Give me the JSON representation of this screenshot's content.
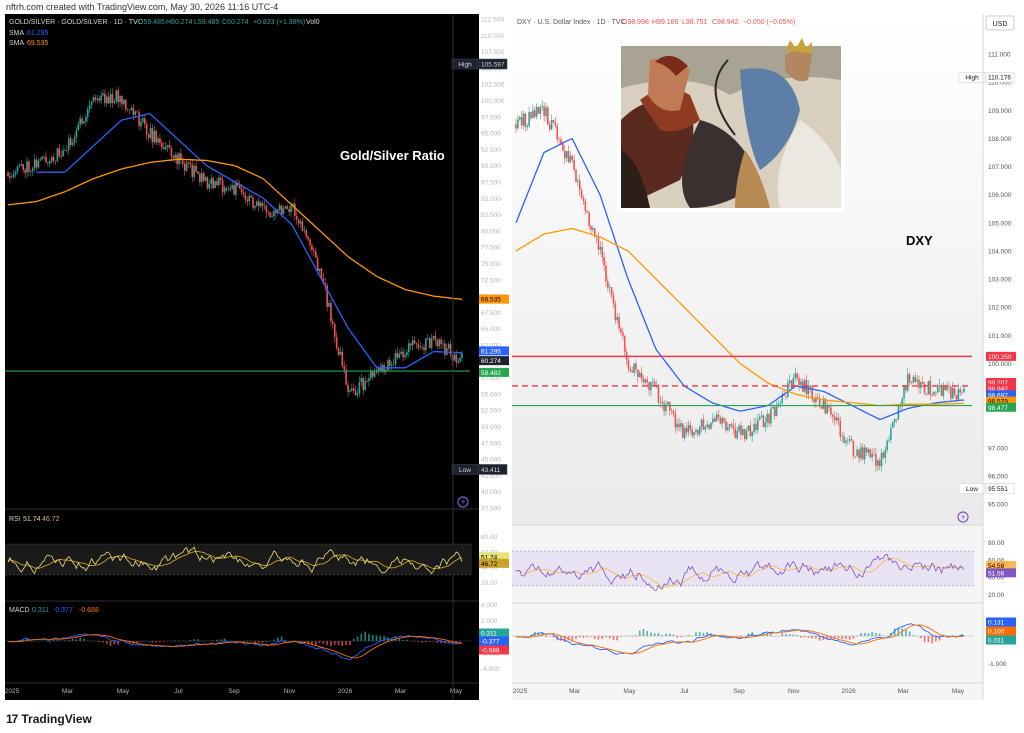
{
  "header": "nftrh.com created with TradingView.com, May 30, 2026 11:16 UTC-4",
  "footer": {
    "logo_mark": "17",
    "brand": "TradingView"
  },
  "colors": {
    "sma_fast": "#2962ff",
    "sma_slow": "#ff9800",
    "support": "#26a651",
    "resistance": "#f23645",
    "up": "#26a69a",
    "down": "#ef5350",
    "rsi_left": "#e8e079",
    "rsi_right": "#7e57c2",
    "macd": "#2962ff",
    "signal": "#ff6d00"
  },
  "left_panel": {
    "title": "GOLD/SILVER · GOLD/SILVER · 1D · TVC",
    "ohlc": {
      "o": "O59.485",
      "h": "H60.274",
      "l": "L59.485",
      "c": "C60.274",
      "chg": "+0.823 (+1.38%)",
      "vol": "Vol0"
    },
    "sma1": {
      "label": "SMA",
      "value": "61.295"
    },
    "sma2": {
      "label": "SMA",
      "value": "69.535"
    },
    "annotation": "Gold/Silver Ratio",
    "high_label": "High",
    "high_value": "105.597",
    "low_label": "Low",
    "low_value": "43.411",
    "price_tags": [
      {
        "text": "69.535",
        "price": 69.535,
        "bg": "#ff9800",
        "fg": "#000000"
      },
      {
        "text": "61.295",
        "price": 61.6,
        "bg": "#2962ff",
        "fg": "#ffffff"
      },
      {
        "text": "60.274",
        "price": 60.1,
        "bg": "#1e222d",
        "fg": "#ffffff"
      },
      {
        "text": "58.482",
        "price": 58.3,
        "bg": "#26a651",
        "fg": "#ffffff"
      }
    ],
    "rsi": {
      "label": "RSI",
      "v1": "51.74",
      "v2": "46.72",
      "ticks": [
        "60.00",
        "40.00",
        "20.00"
      ],
      "tag1": "51.74",
      "tag2": "46.72",
      "tick_top": "80.00"
    },
    "macd": {
      "label": "MACD",
      "v1": "0.311",
      "v2": "-0.377",
      "v3": "-0.688",
      "ticks": [
        "4.000",
        "2.000",
        "-2.000",
        "-4.000"
      ],
      "tag1": "0.311",
      "tag2": "-0.377",
      "tag3": "-0.688"
    },
    "x_labels": [
      "2025",
      "Mar",
      "May",
      "Jul",
      "Sep",
      "Nov",
      "2026",
      "Mar",
      "May"
    ]
  },
  "right_panel": {
    "title": "DXY · U.S. Dollar Index · 1D · TVC",
    "ohlc": {
      "o": "O98.998",
      "h": "H99.186",
      "l": "L98.751",
      "c": "C98.942",
      "chg": "−0.050 (−0.05%)"
    },
    "currency": "USD",
    "annotation": "DXY",
    "high_label": "High",
    "high_value": "110.176",
    "low_label": "Low",
    "low_value": "95.551",
    "price_tags": [
      {
        "text": "100.250",
        "price": 100.25,
        "bg": "#f23645",
        "fg": "#ffffff"
      },
      {
        "text": "99.207",
        "price": 99.32,
        "bg": "#f23645",
        "fg": "#ffffff"
      },
      {
        "text": "98.942",
        "price": 99.1,
        "bg": "#f23645",
        "fg": "#ffffff"
      },
      {
        "text": "98.697",
        "price": 98.88,
        "bg": "#2962ff",
        "fg": "#ffffff"
      },
      {
        "text": "98.579",
        "price": 98.66,
        "bg": "#ff9800",
        "fg": "#000000"
      },
      {
        "text": "98.477",
        "price": 98.44,
        "bg": "#26a651",
        "fg": "#ffffff"
      }
    ],
    "rsi": {
      "ticks": [
        "80.00",
        "60.00",
        "40.00",
        "20.00"
      ],
      "tag1": "54.58",
      "tag2": "51.56"
    },
    "macd": {
      "ticks": [
        "0.131",
        "0.100",
        "0.031",
        "-1.000"
      ],
      "tag1": "0.131",
      "tag2": "0.100",
      "tag3": "0.031"
    },
    "x_labels": [
      "2025",
      "Mar",
      "May",
      "Jul",
      "Sep",
      "Nov",
      "2026",
      "Mar",
      "May"
    ]
  },
  "chart_data": [
    {
      "type": "line",
      "title": "GOLD/SILVER · GOLD/SILVER · 1D · TVC",
      "x": [
        "2025-01",
        "2025-02",
        "2025-03",
        "2025-04",
        "2025-05",
        "2025-06",
        "2025-07",
        "2025-08",
        "2025-09",
        "2025-10",
        "2025-11",
        "2025-12",
        "2026-01",
        "2026-02",
        "2026-03",
        "2026-04",
        "2026-05"
      ],
      "series": [
        {
          "name": "GOLD/SILVER",
          "values": [
            89,
            90.5,
            92,
            100.5,
            100.5,
            95,
            91,
            87.5,
            86.5,
            83,
            84,
            74,
            55,
            58,
            62,
            63,
            60.3
          ]
        },
        {
          "name": "SMA",
          "values": [
            null,
            null,
            89,
            93,
            97,
            98,
            94,
            90,
            87.5,
            85,
            81,
            73,
            65,
            59,
            59,
            61.5,
            61.3
          ]
        },
        {
          "name": "SMA",
          "values": [
            84,
            84.5,
            86,
            88,
            89.5,
            90.5,
            91,
            90.8,
            90,
            88,
            84,
            80,
            76,
            73,
            71,
            70,
            69.5
          ]
        }
      ],
      "ylim": [
        37.5,
        112.5
      ],
      "yticks": [
        "112.500",
        "110.000",
        "107.500",
        "105.000",
        "102.500",
        "100.000",
        "97.500",
        "95.000",
        "92.500",
        "90.000",
        "87.500",
        "85.000",
        "82.500",
        "80.000",
        "77.500",
        "75.000",
        "72.500",
        "70.000",
        "67.500",
        "65.000",
        "62.500",
        "57.500",
        "55.000",
        "52.500",
        "50.000",
        "47.500",
        "45.000",
        "42.500",
        "40.000",
        "37.500"
      ],
      "high": 105.597,
      "low": 43.411,
      "support_line": 58.5
    },
    {
      "type": "line",
      "title": "DXY · U.S. Dollar Index · 1D · TVC",
      "x": [
        "2025-01",
        "2025-02",
        "2025-03",
        "2025-04",
        "2025-05",
        "2025-06",
        "2025-07",
        "2025-08",
        "2025-09",
        "2025-10",
        "2025-11",
        "2025-12",
        "2026-01",
        "2026-02",
        "2026-03",
        "2026-04",
        "2026-05"
      ],
      "series": [
        {
          "name": "DXY",
          "values": [
            108.5,
            109,
            107,
            104,
            100,
            99,
            97.5,
            98,
            97.5,
            98,
            99.5,
            98.5,
            97,
            96.5,
            99.5,
            99,
            98.9
          ]
        },
        {
          "name": "SMA",
          "values": [
            105,
            107.5,
            108,
            106,
            103,
            100.5,
            99.2,
            98.6,
            98.3,
            98.5,
            99.2,
            99,
            98.5,
            98,
            98.4,
            98.6,
            98.7
          ]
        },
        {
          "name": "SMA",
          "values": [
            104,
            104.6,
            104.8,
            104.5,
            104,
            103,
            102,
            101,
            100,
            99.3,
            98.9,
            98.7,
            98.6,
            98.5,
            98.55,
            98.55,
            98.58
          ]
        }
      ],
      "ylim": [
        95,
        111.5
      ],
      "yticks": [
        "111.000",
        "110.000",
        "109.000",
        "108.000",
        "107.000",
        "106.000",
        "105.000",
        "104.000",
        "103.000",
        "102.000",
        "101.000",
        "100.000",
        "97.000",
        "96.000",
        "95.000"
      ],
      "high": 110.176,
      "low": 95.551,
      "resistance_line": 100.25,
      "dashed_line": 99.2,
      "support_line": 98.5
    }
  ]
}
